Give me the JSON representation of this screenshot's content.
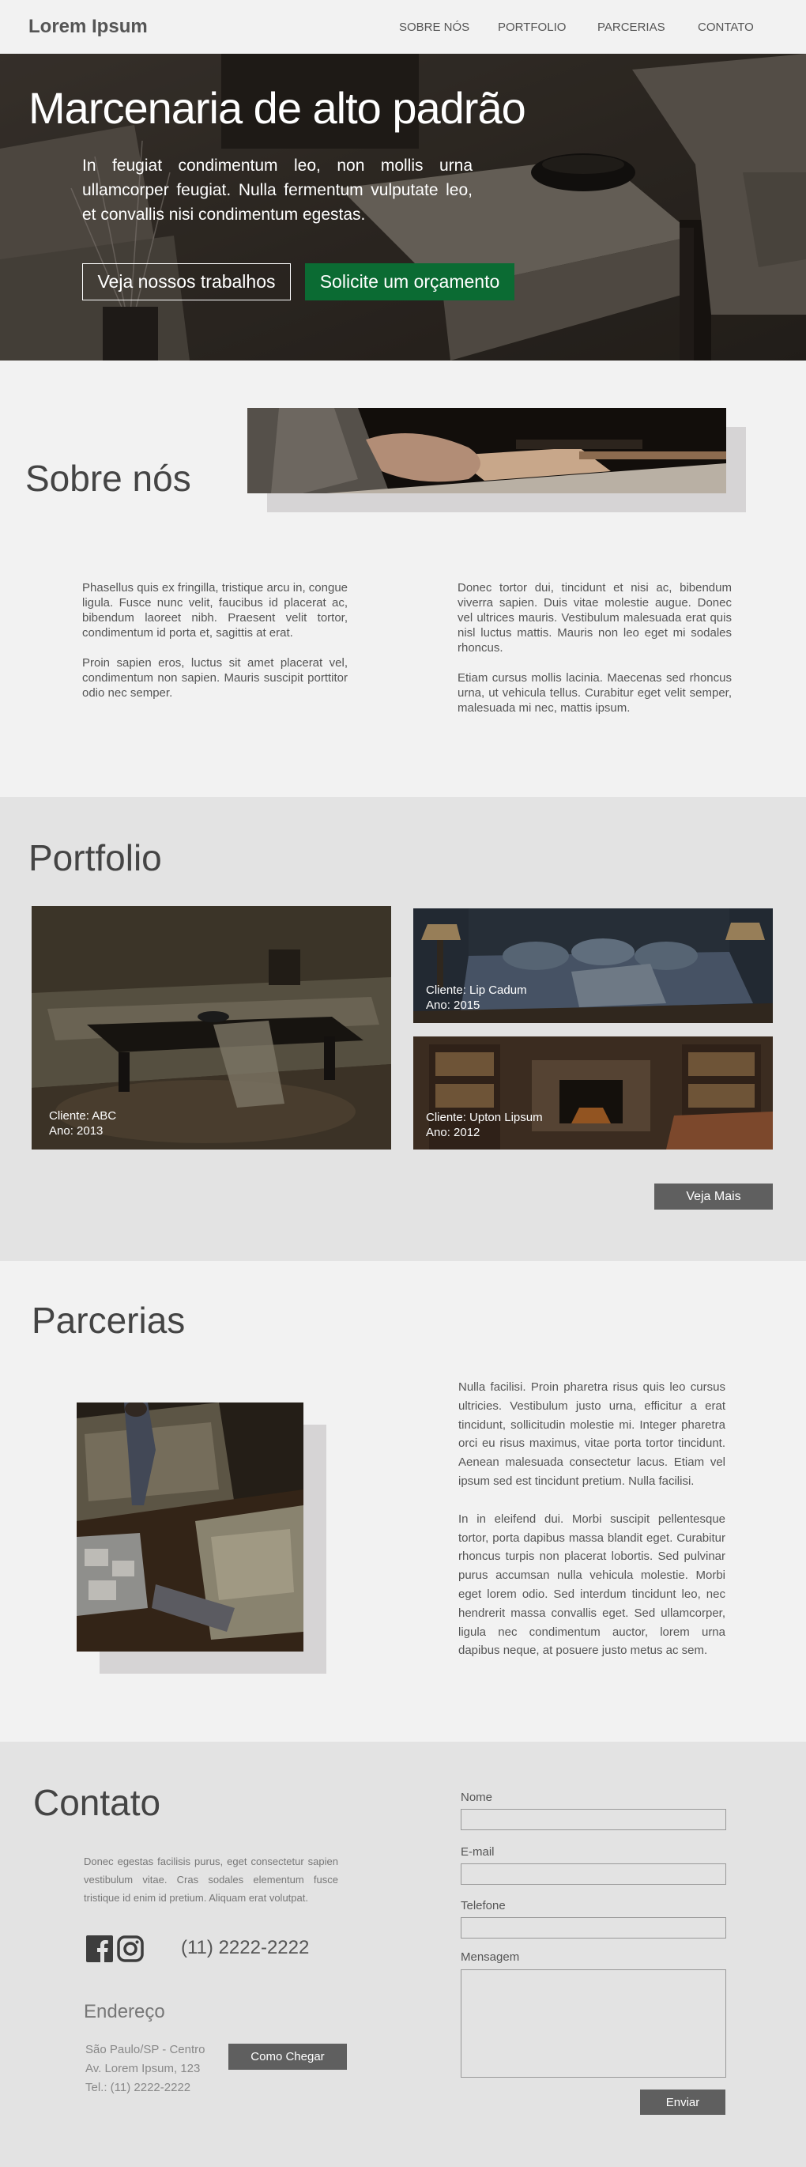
{
  "header": {
    "logo": "Lorem Ipsum",
    "nav": [
      "SOBRE NÓS",
      "PORTFOLIO",
      "PARCERIAS",
      "CONTATO"
    ]
  },
  "hero": {
    "title": "Marcenaria de alto padrão",
    "text": "In feugiat condimentum leo, non mollis urna ullamcorper feugiat. Nulla fermentum vulputate leo, et convallis nisi condimentum egestas.",
    "btn_works": "Veja nossos trabalhos",
    "btn_quote": "Solicite um orçamento"
  },
  "sobre": {
    "title": "Sobre nós",
    "col1": [
      "Phasellus quis ex fringilla, tristique arcu in, congue ligula. Fusce nunc velit, faucibus id placerat ac, bibendum laoreet nibh. Praesent velit tortor, condimentum id porta et, sagittis at erat.",
      "Proin sapien eros, luctus sit amet placerat vel, condimentum non sapien. Mauris suscipit porttitor odio nec semper."
    ],
    "col2": [
      "Donec tortor dui, tincidunt et nisi ac, bibendum viverra sapien. Duis vitae molestie augue. Donec vel ultrices mauris. Vestibulum malesuada erat quis nisl luctus mattis. Mauris non leo eget mi sodales rhoncus.",
      "Etiam cursus mollis lacinia. Maecenas sed rhoncus urna, ut vehicula tellus. Curabitur eget velit semper, malesuada mi nec, mattis ipsum."
    ]
  },
  "portfolio": {
    "title": "Portfolio",
    "items": [
      {
        "cliente": "Cliente: ABC",
        "ano": "Ano: 2013"
      },
      {
        "cliente": "Cliente: Lip Cadum",
        "ano": "Ano: 2015"
      },
      {
        "cliente": "Cliente: Upton Lipsum",
        "ano": "Ano: 2012"
      }
    ],
    "btn_more": "Veja Mais"
  },
  "parcerias": {
    "title": "Parcerias",
    "paragraphs": [
      "Nulla facilisi. Proin pharetra risus quis leo cursus ultricies. Vestibulum justo urna, efficitur a erat tincidunt, sollicitudin molestie mi. Integer pharetra orci eu risus maximus, vitae porta tortor tincidunt. Aenean malesuada consectetur lacus. Etiam vel ipsum sed est tincidunt pretium. Nulla facilisi.",
      "In in eleifend dui. Morbi suscipit pellentesque tortor, porta dapibus massa blandit eget. Curabitur rhoncus turpis non placerat lobortis. Sed pulvinar purus accumsan nulla vehicula molestie. Morbi eget lorem odio. Sed interdum tincidunt leo, nec hendrerit massa convallis eget. Sed ullamcorper, ligula nec condimentum auctor, lorem urna dapibus neque, at posuere justo metus ac sem."
    ]
  },
  "contato": {
    "title": "Contato",
    "description": "Donec egestas facilisis purus, eget consectetur sapien vestibulum vitae. Cras sodales elementum fusce tristique id enim id pretium. Aliquam erat volutpat.",
    "phone": "(11) 2222-2222",
    "endereco_title": "Endereço",
    "endereco_lines": [
      "São Paulo/SP - Centro",
      "Av. Lorem Ipsum, 123",
      "Tel.: (11) 2222-2222"
    ],
    "btn_directions": "Como Chegar",
    "form": {
      "name_label": "Nome",
      "email_label": "E-mail",
      "phone_label": "Telefone",
      "message_label": "Mensagem",
      "submit": "Enviar"
    }
  },
  "icons": {
    "facebook": "facebook-icon",
    "instagram": "instagram-icon"
  },
  "colors": {
    "accent_green": "#0b6b33",
    "button_gray": "#5f5f5f",
    "background_light": "#f2f2f2",
    "background_gray": "#e3e3e3"
  }
}
